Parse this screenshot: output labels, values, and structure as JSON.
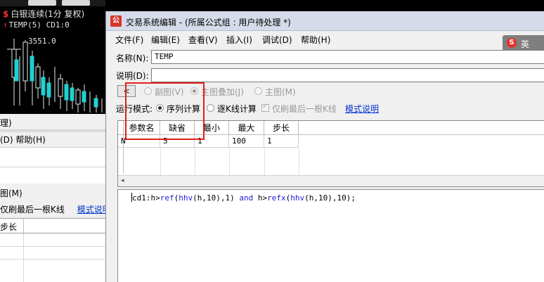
{
  "chart": {
    "title": "白银连续(1分 复权)",
    "indicator": "TEMP(5) CD1:0",
    "price_label": "3551.0"
  },
  "bg_window": {
    "row1": "理)",
    "menu_tail": "(D)  帮助(H)",
    "row_tu": "图(M)",
    "row_only": "仅刷最后一根K线",
    "link": "模式说明",
    "table_header": "步长"
  },
  "dialog": {
    "title": "交易系统编辑 - (所属公式组 : 用户待处理 *)",
    "menu": [
      "文件(F)",
      "编辑(E)",
      "查看(V)",
      "插入(I)",
      "调试(D)",
      "帮助(H)"
    ],
    "ime": {
      "icon": "sogou-ime-icon",
      "text": "英"
    },
    "name_label": "名称(N):",
    "name_value": "TEMP",
    "desc_label": "说明(D):",
    "desc_value": "",
    "nav_button": "<",
    "chart_options": [
      {
        "label": "副图(V)",
        "selected": false,
        "enabled": false
      },
      {
        "label": "主图叠加(J)",
        "selected": true,
        "enabled": false
      },
      {
        "label": "主图(M)",
        "selected": false,
        "enabled": false
      }
    ],
    "run_mode_label": "运行模式:",
    "run_modes": [
      {
        "label": "序列计算",
        "selected": true
      },
      {
        "label": "逐K线计算",
        "selected": false
      }
    ],
    "only_last_bar": {
      "label": "仅刷最后一根K线",
      "checked": true,
      "enabled": false
    },
    "mode_help_link": "模式说明",
    "param_table": {
      "headers": [
        "参数名",
        "缺省",
        "最小",
        "最大",
        "步长"
      ],
      "rows": [
        [
          "N",
          "5",
          "1",
          "100",
          "1"
        ]
      ]
    },
    "code": {
      "p1": "cd1:h>",
      "k1": "ref",
      "p2": "(",
      "k2": "hhv",
      "p3": "(h,10),1) ",
      "k3": "and",
      "p4": " h>",
      "k4": "refx",
      "p5": "(",
      "k5": "hhv",
      "p6": "(h,10),10);"
    }
  }
}
